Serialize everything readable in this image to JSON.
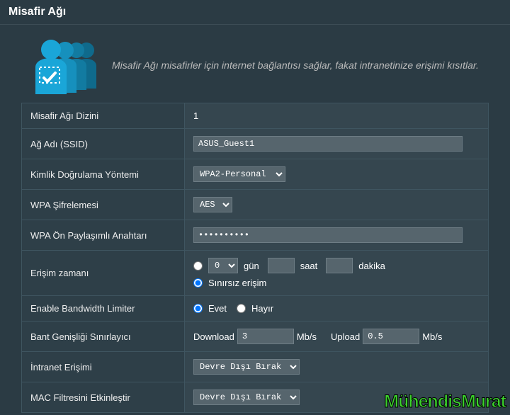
{
  "page": {
    "title": "Misafir Ağı",
    "description": "Misafir Ağı misafirler için internet bağlantısı sağlar, fakat intranetinize erişimi kısıtlar."
  },
  "rows": {
    "index": {
      "label": "Misafir Ağı Dizini",
      "value": "1"
    },
    "ssid": {
      "label": "Ağ Adı (SSID)",
      "value": "ASUS_Guest1"
    },
    "auth": {
      "label": "Kimlik Doğrulama Yöntemi",
      "value": "WPA2-Personal"
    },
    "encryption": {
      "label": "WPA Şifrelemesi",
      "value": "AES"
    },
    "psk": {
      "label": "WPA Ön Paylaşımlı Anahtarı",
      "value": "••••••••••"
    },
    "access_time": {
      "label": "Erişim zamanı",
      "day_value": "0",
      "day_unit": "gün",
      "hour_value": "",
      "hour_unit": "saat",
      "minute_value": "",
      "minute_unit": "dakika",
      "unlimited_label": "Sınırsız erişim",
      "mode": "unlimited"
    },
    "bw_limiter": {
      "label": "Enable Bandwidth Limiter",
      "yes": "Evet",
      "no": "Hayır",
      "value": "Evet"
    },
    "bw_limits": {
      "label": "Bant Genişliği Sınırlayıcı",
      "download_label": "Download",
      "download_value": "3",
      "upload_label": "Upload",
      "upload_value": "0.5",
      "unit": "Mb/s"
    },
    "intranet": {
      "label": "İntranet Erişimi",
      "value": "Devre Dışı Bırak"
    },
    "macfilter": {
      "label": "MAC Filtresini Etkinleştir",
      "value": "Devre Dışı Bırak"
    }
  },
  "watermark": "MühendisMurat"
}
